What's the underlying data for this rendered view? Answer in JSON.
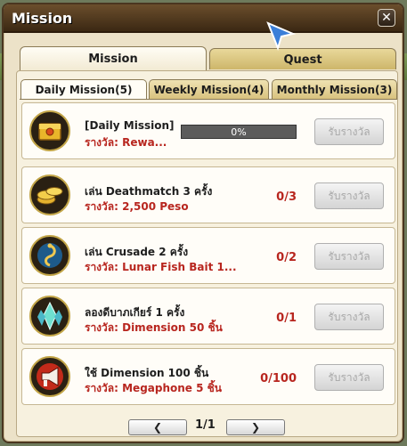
{
  "window": {
    "title": "Mission",
    "close_glyph": "✕"
  },
  "main_tabs": [
    {
      "label": "Mission",
      "active": true
    },
    {
      "label": "Quest",
      "active": false
    }
  ],
  "sub_tabs": [
    {
      "label": "Daily Mission(5)",
      "active": true
    },
    {
      "label": "Weekly Mission(4)",
      "active": false
    },
    {
      "label": "Monthly Mission(3)",
      "active": false
    }
  ],
  "missions": [
    {
      "icon": "golden-chest-icon",
      "name": "[Daily Mission]",
      "reward": "รางวัล: Rewa...",
      "progress_type": "bar",
      "progress": 0,
      "progress_text": "0%",
      "button": "รับรางวัล"
    },
    {
      "icon": "gold-coins-icon",
      "name": "เล่น Deathmatch 3 ครั้ง",
      "reward": "รางวัล: 2,500 Peso",
      "progress_type": "count",
      "progress_text": "0/3",
      "button": "รับรางวัล"
    },
    {
      "icon": "fish-bait-icon",
      "name": "เล่น Crusade 2 ครั้ง",
      "reward": "รางวัล: Lunar Fish Bait 1...",
      "progress_type": "count",
      "progress_text": "0/2",
      "button": "รับรางวัล"
    },
    {
      "icon": "crystal-icon",
      "name": "ลองดีบาภเกียร์ 1 ครั้ง",
      "reward": "รางวัล: Dimension 50 ชิ้น",
      "progress_type": "count",
      "progress_text": "0/1",
      "button": "รับรางวัล"
    },
    {
      "icon": "megaphone-icon",
      "name": "ใช้ Dimension 100 ชิ้น",
      "reward": "รางวัล: Megaphone 5 ชิ้น",
      "progress_type": "count",
      "progress_text": "0/100",
      "button": "รับรางวัล"
    }
  ],
  "pager": {
    "prev_glyph": "❮",
    "next_glyph": "❯",
    "page_text": "1/1"
  },
  "colors": {
    "reward_red": "#b8261f",
    "title_bar": "#3b2813",
    "panel": "#f7f1df"
  }
}
